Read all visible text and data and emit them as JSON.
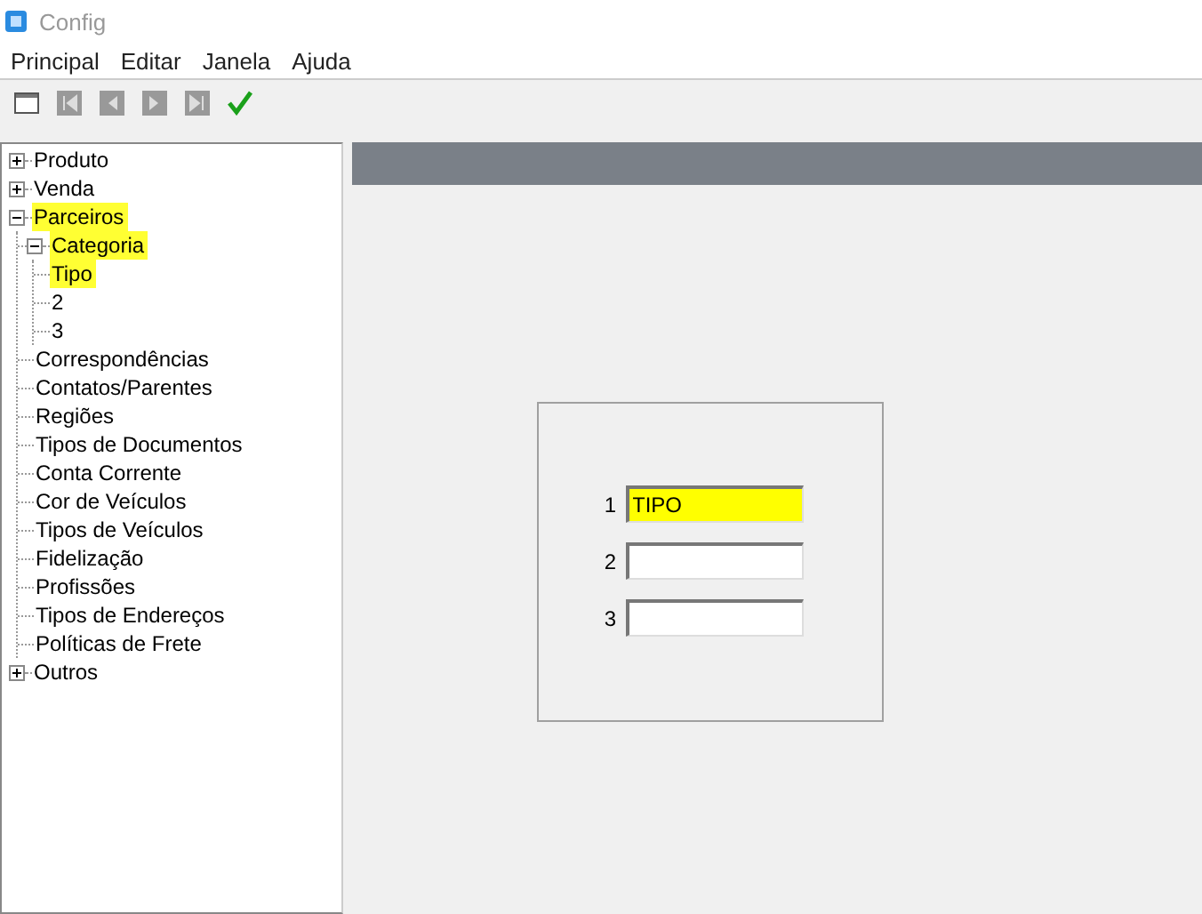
{
  "window": {
    "title": "Config"
  },
  "menu": [
    "Principal",
    "Editar",
    "Janela",
    "Ajuda"
  ],
  "tree": [
    {
      "label": "Produto",
      "expanded": false,
      "highlighted": false
    },
    {
      "label": "Venda",
      "expanded": false,
      "highlighted": false
    },
    {
      "label": "Parceiros",
      "expanded": true,
      "highlighted": true,
      "children": [
        {
          "label": "Categoria",
          "expanded": true,
          "highlighted": true,
          "children": [
            {
              "label": "Tipo",
              "highlighted": true
            },
            {
              "label": "2",
              "highlighted": false
            },
            {
              "label": "3",
              "highlighted": false
            }
          ]
        },
        {
          "label": "Correspondências",
          "highlighted": false
        },
        {
          "label": "Contatos/Parentes",
          "highlighted": false
        },
        {
          "label": "Regiões",
          "highlighted": false
        },
        {
          "label": "Tipos de Documentos",
          "highlighted": false
        },
        {
          "label": "Conta Corrente",
          "highlighted": false
        },
        {
          "label": "Cor de Veículos",
          "highlighted": false
        },
        {
          "label": "Tipos de Veículos",
          "highlighted": false
        },
        {
          "label": "Fidelização",
          "highlighted": false
        },
        {
          "label": "Profissões",
          "highlighted": false
        },
        {
          "label": "Tipos de Endereços",
          "highlighted": false
        },
        {
          "label": "Políticas de Frete",
          "highlighted": false
        }
      ]
    },
    {
      "label": "Outros",
      "expanded": false,
      "highlighted": false
    }
  ],
  "fields": [
    {
      "label": "1",
      "value": "TIPO",
      "highlighted": true
    },
    {
      "label": "2",
      "highlighted": false
    },
    {
      "label": "3",
      "highlighted": false
    }
  ]
}
